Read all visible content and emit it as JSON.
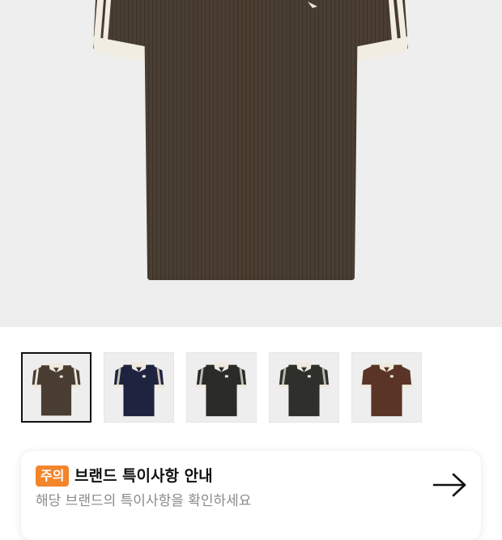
{
  "product": {
    "main_image_color": "#4a3e32",
    "thumbnails": [
      {
        "body_color": "#4a3e32",
        "stripe_color": "#efeadd",
        "selected": true
      },
      {
        "body_color": "#1e2340",
        "stripe_color": "#c8c4b4",
        "selected": false
      },
      {
        "body_color": "#2b2b29",
        "stripe_color": "#bdbdb6",
        "selected": false
      },
      {
        "body_color": "#2f302c",
        "stripe_color": "#b9bab2",
        "selected": false
      },
      {
        "body_color": "#5a3426",
        "stripe_color": "#5a3426",
        "selected": false
      }
    ]
  },
  "notice": {
    "badge": "주의",
    "title": "브랜드 특이사항 안내",
    "subtitle": "해당 브랜드의 특이사항을 확인하세요",
    "badge_color": "#f3852a",
    "arrow_icon": "arrow-right-icon"
  }
}
